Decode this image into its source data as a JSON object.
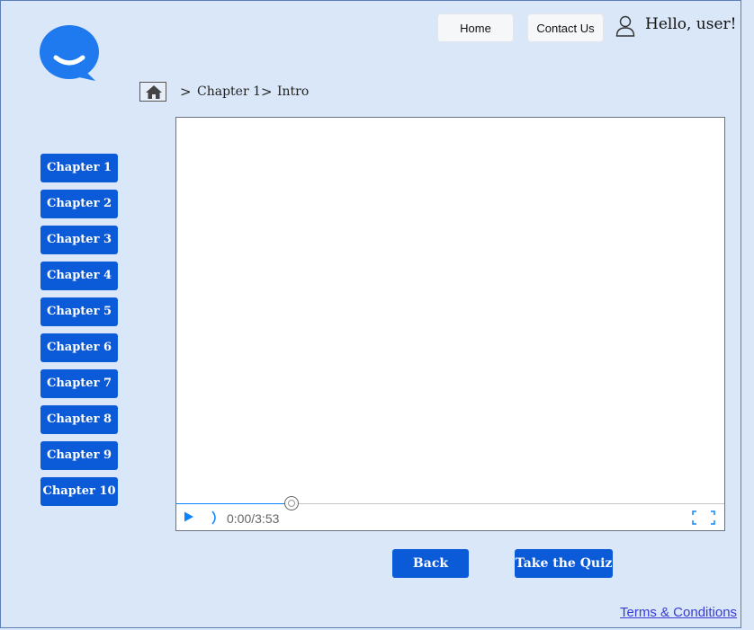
{
  "header": {
    "home_label": "Home",
    "contact_label": "Contact Us",
    "greeting": "Hello, user!"
  },
  "breadcrumb": {
    "separator": ">",
    "items": [
      "Chapter 1",
      "Intro"
    ]
  },
  "sidebar": {
    "chapters": [
      "Chapter 1",
      "Chapter 2",
      "Chapter 3",
      "Chapter 4",
      "Chapter 5",
      "Chapter 6",
      "Chapter 7",
      "Chapter 8",
      "Chapter 9",
      "Chapter 10"
    ]
  },
  "video": {
    "time": "0:00/3:53",
    "progress_fraction": 0.21
  },
  "actions": {
    "back_label": "Back",
    "quiz_label": "Take the Quiz"
  },
  "footer": {
    "terms_label": "Terms & Conditions"
  },
  "colors": {
    "background": "#d9e7f9",
    "primary": "#0b5ad8",
    "logo": "#1f7af0",
    "link": "#3a3ad6"
  },
  "icons": [
    "chat-logo-icon",
    "user-icon",
    "home-icon",
    "play-icon",
    "volume-icon",
    "fullscreen-icon"
  ]
}
